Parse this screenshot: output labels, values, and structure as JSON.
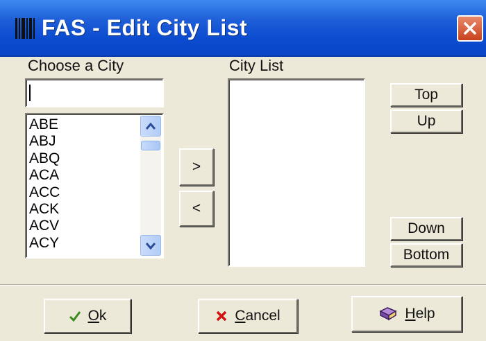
{
  "window": {
    "title": "FAS - Edit City List"
  },
  "choose": {
    "label": "Choose a City",
    "input_value": "",
    "cities": [
      "ABE",
      "ABJ",
      "ABQ",
      "ACA",
      "ACC",
      "ACK",
      "ACV",
      "ACY"
    ]
  },
  "city_list": {
    "label": "City List",
    "items": []
  },
  "transfer": {
    "add_label": ">",
    "remove_label": "<"
  },
  "order": {
    "top_label": "Top",
    "up_label": "Up",
    "down_label": "Down",
    "bottom_label": "Bottom"
  },
  "footer": {
    "ok": {
      "mnemonic": "O",
      "rest": "k"
    },
    "cancel": {
      "mnemonic": "C",
      "rest": "ancel"
    },
    "help": {
      "mnemonic": "H",
      "rest": "elp"
    }
  },
  "colors": {
    "title_bar": "#0b4bd0",
    "dialog_bg": "#ece9d8",
    "close_button": "#c8421f",
    "ok_check": "#3a8a1c",
    "cancel_x": "#d01010"
  },
  "icons": [
    "app-barcode-icon",
    "close-icon",
    "scroll-up-icon",
    "scroll-down-icon",
    "checkmark-icon",
    "x-icon",
    "help-book-icon"
  ]
}
